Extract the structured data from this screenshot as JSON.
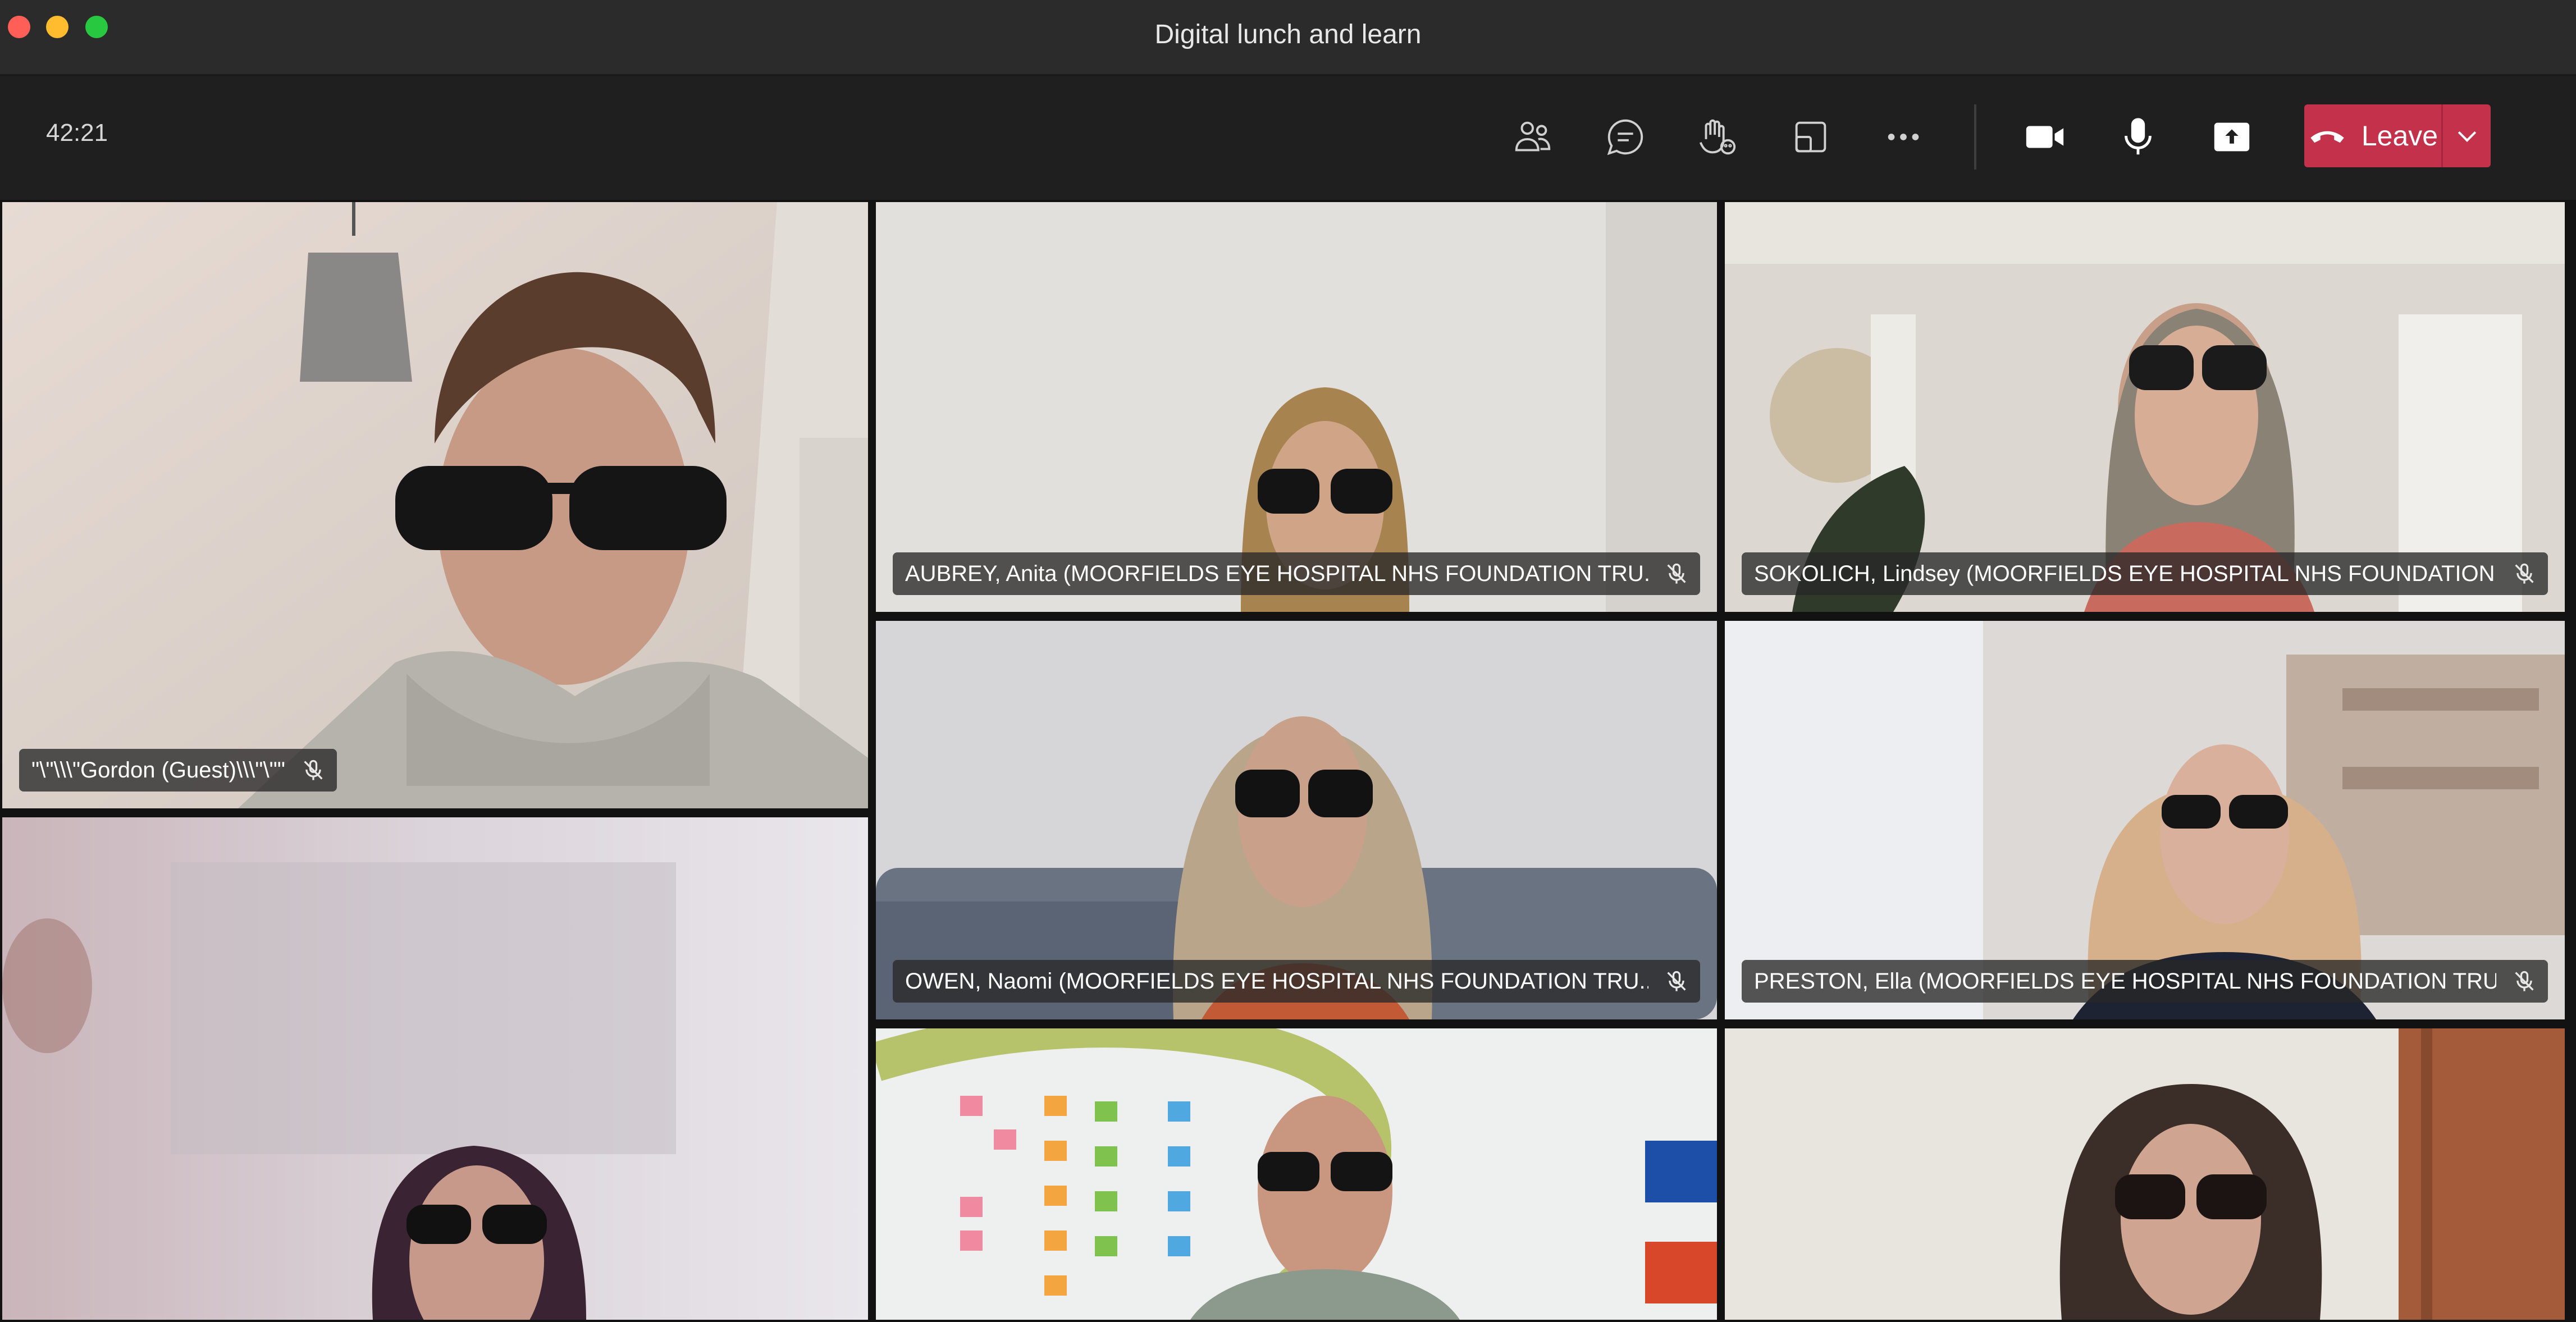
{
  "window": {
    "title": "Digital lunch and learn"
  },
  "toolbar": {
    "timer": "42:21",
    "buttons": [
      {
        "name": "participants-button",
        "icon": "people-icon"
      },
      {
        "name": "chat-button",
        "icon": "chat-icon"
      },
      {
        "name": "reactions-button",
        "icon": "raise-hand-icon"
      },
      {
        "name": "rooms-button",
        "icon": "breakout-rooms-icon"
      },
      {
        "name": "more-actions-button",
        "icon": "more-icon"
      },
      {
        "name": "camera-button",
        "icon": "camera-icon"
      },
      {
        "name": "mic-button",
        "icon": "microphone-icon"
      },
      {
        "name": "share-button",
        "icon": "share-tray-icon"
      }
    ],
    "leave_label": "Leave",
    "leave_color": "#c4314b"
  },
  "participants": [
    {
      "name": "\"\\\"\\\\\\\"Gordon (Guest)\\\\\\\"\\\"\"",
      "muted": true
    },
    {
      "name": "AUBREY, Anita (MOORFIELDS EYE HOSPITAL NHS FOUNDATION TRU...",
      "muted": true
    },
    {
      "name": "SOKOLICH, Lindsey (MOORFIELDS EYE HOSPITAL NHS FOUNDATION ...",
      "muted": true
    },
    {
      "name": "",
      "muted": false
    },
    {
      "name": "OWEN, Naomi (MOORFIELDS EYE HOSPITAL NHS FOUNDATION TRU...",
      "muted": true
    },
    {
      "name": "PRESTON, Ella (MOORFIELDS EYE HOSPITAL NHS FOUNDATION TRU...",
      "muted": true
    },
    {
      "name": "",
      "muted": false
    },
    {
      "name": "",
      "muted": false
    }
  ]
}
